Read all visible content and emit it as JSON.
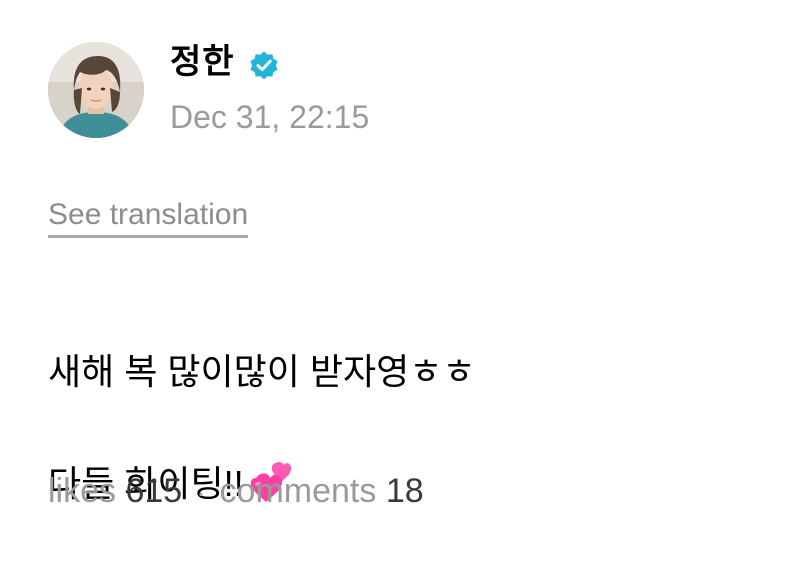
{
  "post": {
    "author_name": "정한",
    "verified": true,
    "timestamp": "Dec 31, 22:15",
    "translate_label": "See translation",
    "body_line1": "새해 복 많이많이 받자영ㅎㅎ",
    "body_line2": "다들 화이팅!!",
    "emoji": "two-hearts-icon",
    "likes_label": "likes",
    "likes_count": "615",
    "separator": "·",
    "comments_label": "comments",
    "comments_count": "18"
  },
  "colors": {
    "verified_badge": "#22b5d8",
    "meta_gray": "#9a9a9a",
    "heart_pink": "#ff3fa4"
  }
}
